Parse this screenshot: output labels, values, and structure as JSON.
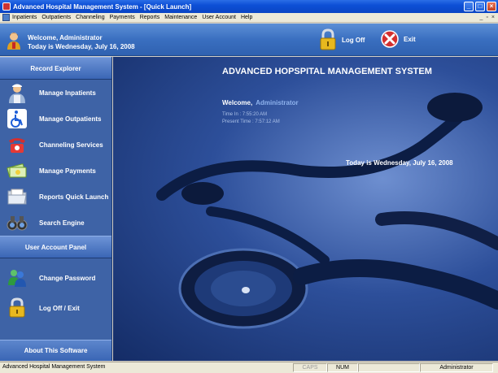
{
  "window": {
    "title": "Advanced Hospital Management System - [Quick Launch]",
    "controls": {
      "minimize": "_",
      "maximize": "□",
      "close": "×"
    }
  },
  "menu": {
    "items": [
      "Inpatients",
      "Outpatients",
      "Channeling",
      "Payments",
      "Reports",
      "Maintenance",
      "User Account",
      "Help"
    ],
    "mdi": {
      "minimize": "_",
      "restore": "▫",
      "close": "×"
    }
  },
  "header": {
    "welcome_line": "Welcome, Administrator",
    "date_line": "Today is Wednesday, July 16, 2008",
    "logoff_label": "Log Off",
    "exit_label": "Exit",
    "icons": {
      "user": "user-icon",
      "logoff": "padlock-icon",
      "exit": "exit-x-icon"
    }
  },
  "sidebar": {
    "record_header": "Record Explorer",
    "record_items": [
      {
        "label": "Manage Inpatients",
        "icon": "nurse-icon"
      },
      {
        "label": "Manage Outpatients",
        "icon": "wheelchair-icon"
      },
      {
        "label": "Channeling Services",
        "icon": "telephone-icon"
      },
      {
        "label": "Manage Payments",
        "icon": "money-icon"
      },
      {
        "label": "Reports Quick Launch",
        "icon": "folder-icon"
      },
      {
        "label": "Search Engine",
        "icon": "binoculars-icon"
      }
    ],
    "account_header": "User Account Panel",
    "account_items": [
      {
        "label": "Change Password",
        "icon": "users-icon"
      },
      {
        "label": "Log Off / Exit",
        "icon": "padlock-icon"
      }
    ],
    "about": "About This Software"
  },
  "main": {
    "title": "ADVANCED HOPSPITAL MANAGEMENT SYSTEM",
    "welcome_prefix": "Welcome,",
    "welcome_name": "Administrator",
    "time_in": "Time In :   7:55:20 AM",
    "present_time": "Present Time :   7:57:12 AM",
    "date": "Today is Wednesday, July 16, 2008"
  },
  "status": {
    "app": "Advanced Hospital Management System",
    "caps": "CAPS",
    "num": "NUM",
    "blank": "",
    "user": "Administrator"
  },
  "colors": {
    "sidebar": "#3e63a6",
    "header": "#3a6fc0",
    "titlebar": "#0d4fd6"
  }
}
